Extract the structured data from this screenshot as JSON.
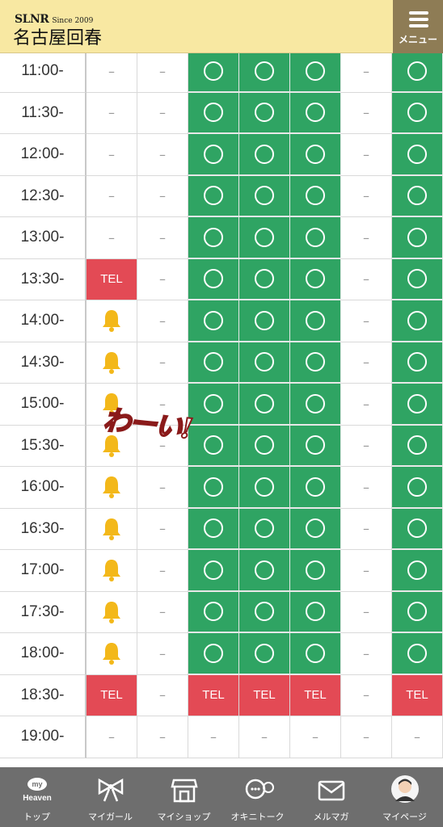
{
  "header": {
    "brand": "SLNR",
    "since": "Since 2009",
    "name": "名古屋回春",
    "menu_label": "メニュー"
  },
  "schedule": {
    "rows": [
      {
        "time": "11:00-",
        "cells": [
          "-",
          "-",
          "o",
          "o",
          "o",
          "-",
          "o"
        ]
      },
      {
        "time": "11:30-",
        "cells": [
          "-",
          "-",
          "o",
          "o",
          "o",
          "-",
          "o"
        ]
      },
      {
        "time": "12:00-",
        "cells": [
          "-",
          "-",
          "o",
          "o",
          "o",
          "-",
          "o"
        ]
      },
      {
        "time": "12:30-",
        "cells": [
          "-",
          "-",
          "o",
          "o",
          "o",
          "-",
          "o"
        ]
      },
      {
        "time": "13:00-",
        "cells": [
          "-",
          "-",
          "o",
          "o",
          "o",
          "-",
          "o"
        ]
      },
      {
        "time": "13:30-",
        "cells": [
          "TEL",
          "-",
          "o",
          "o",
          "o",
          "-",
          "o"
        ]
      },
      {
        "time": "14:00-",
        "cells": [
          "bell",
          "-",
          "o",
          "o",
          "o",
          "-",
          "o"
        ]
      },
      {
        "time": "14:30-",
        "cells": [
          "bell",
          "-",
          "o",
          "o",
          "o",
          "-",
          "o"
        ]
      },
      {
        "time": "15:00-",
        "cells": [
          "bell",
          "-",
          "o",
          "o",
          "o",
          "-",
          "o"
        ]
      },
      {
        "time": "15:30-",
        "cells": [
          "bell",
          "-",
          "o",
          "o",
          "o",
          "-",
          "o"
        ]
      },
      {
        "time": "16:00-",
        "cells": [
          "bell",
          "-",
          "o",
          "o",
          "o",
          "-",
          "o"
        ]
      },
      {
        "time": "16:30-",
        "cells": [
          "bell",
          "-",
          "o",
          "o",
          "o",
          "-",
          "o"
        ]
      },
      {
        "time": "17:00-",
        "cells": [
          "bell",
          "-",
          "o",
          "o",
          "o",
          "-",
          "o"
        ]
      },
      {
        "time": "17:30-",
        "cells": [
          "bell",
          "-",
          "o",
          "o",
          "o",
          "-",
          "o"
        ]
      },
      {
        "time": "18:00-",
        "cells": [
          "bell",
          "-",
          "o",
          "o",
          "o",
          "-",
          "o"
        ]
      },
      {
        "time": "18:30-",
        "cells": [
          "TEL",
          "-",
          "TEL",
          "TEL",
          "TEL",
          "-",
          "TEL"
        ]
      },
      {
        "time": "19:00-",
        "cells": [
          "-",
          "-",
          "-",
          "-",
          "-",
          "-",
          "-"
        ]
      }
    ],
    "dash_text": "–",
    "tel_text": "TEL",
    "colors": {
      "available": "#2fa463",
      "tel": "#e34a55",
      "bell": "#f3b81a"
    }
  },
  "overlay_text": "わーい!",
  "bottom_nav": [
    {
      "label": "トップ",
      "icon": "my-heaven-icon",
      "icon_text_top": "my",
      "icon_text_bottom": "Heaven"
    },
    {
      "label": "マイガール",
      "icon": "ribbon-icon"
    },
    {
      "label": "マイショップ",
      "icon": "shop-icon"
    },
    {
      "label": "オキニトーク",
      "icon": "chat-icon"
    },
    {
      "label": "メルマガ",
      "icon": "mail-icon"
    },
    {
      "label": "マイページ",
      "icon": "avatar-icon"
    }
  ]
}
